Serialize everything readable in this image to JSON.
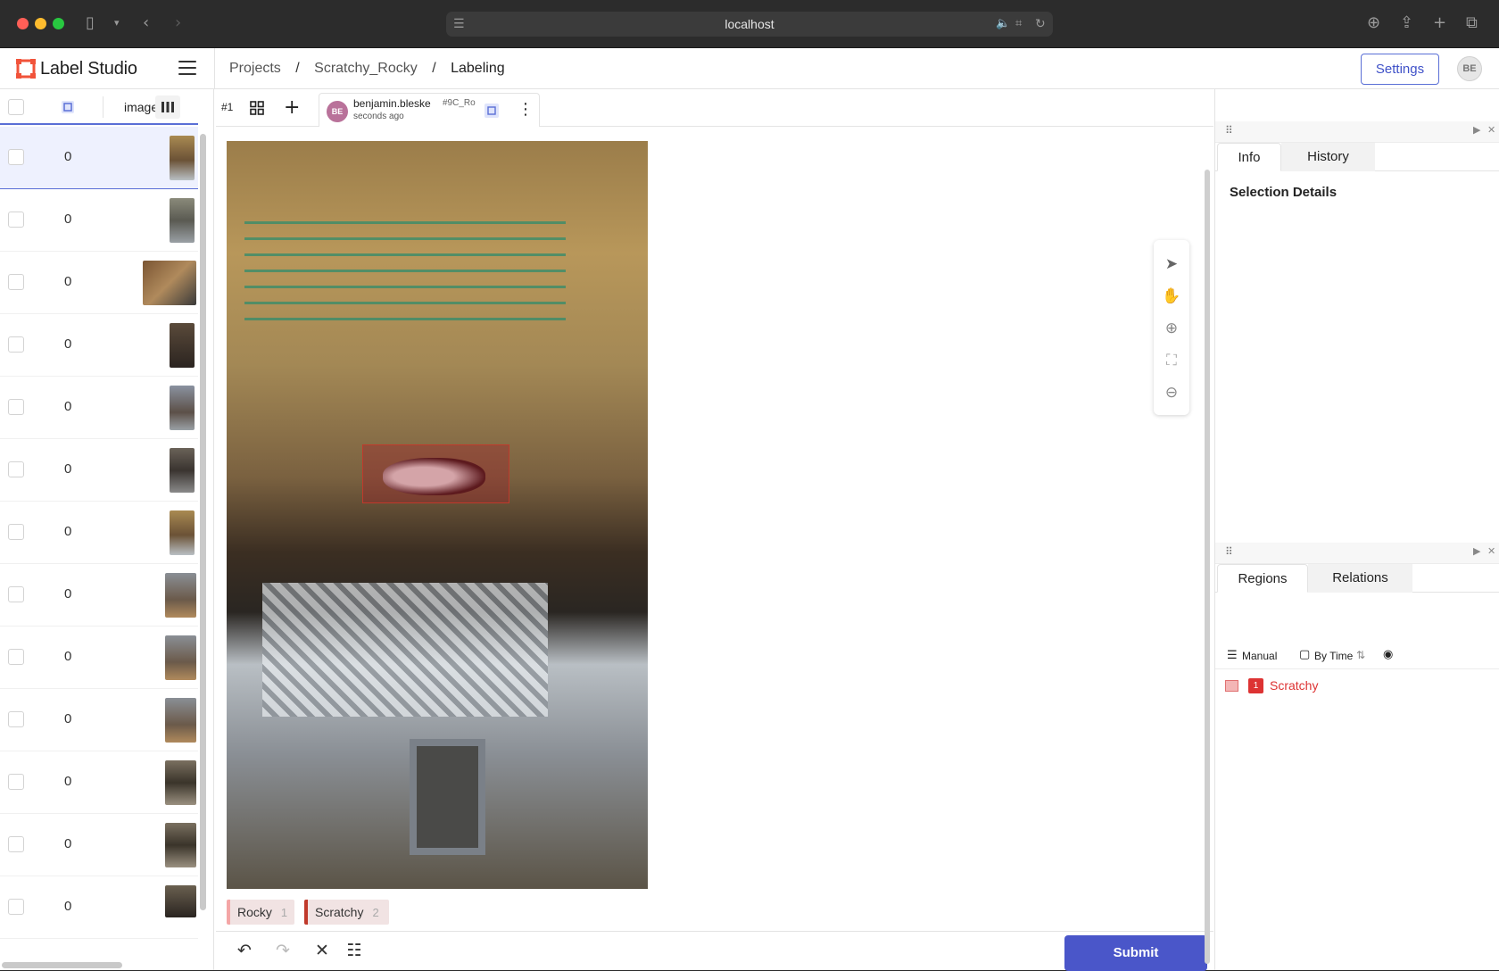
{
  "browser": {
    "url": "localhost"
  },
  "app": {
    "name": "Label Studio"
  },
  "breadcrumb": {
    "projects": "Projects",
    "project": "Scratchy_Rocky",
    "page": "Labeling",
    "sep": "/"
  },
  "header": {
    "settings_label": "Settings",
    "user_initials": "BE"
  },
  "task_list": {
    "column_label": "image",
    "rows": [
      {
        "value": "0"
      },
      {
        "value": "0"
      },
      {
        "value": "0"
      },
      {
        "value": "0"
      },
      {
        "value": "0"
      },
      {
        "value": "0"
      },
      {
        "value": "0"
      },
      {
        "value": "0"
      },
      {
        "value": "0"
      },
      {
        "value": "0"
      },
      {
        "value": "0"
      },
      {
        "value": "0"
      },
      {
        "value": "0"
      }
    ]
  },
  "annotation": {
    "task_id": "#1",
    "user": "benjamin.bleske",
    "user_initials": "BE",
    "id": "#9C_Ro",
    "time": "seconds ago"
  },
  "labels": [
    {
      "name": "Rocky",
      "hotkey": "1",
      "color": "#f4a6a6"
    },
    {
      "name": "Scratchy",
      "hotkey": "2",
      "color": "#c0392b"
    }
  ],
  "submit_label": "Submit",
  "info_panel": {
    "tabs": [
      "Info",
      "History"
    ],
    "selection_title": "Selection Details"
  },
  "regions_panel": {
    "tabs": [
      "Regions",
      "Relations"
    ],
    "sort_manual": "Manual",
    "sort_time": "By Time",
    "regions": [
      {
        "index": "1",
        "label": "Scratchy",
        "color": "#dd3333"
      }
    ]
  }
}
